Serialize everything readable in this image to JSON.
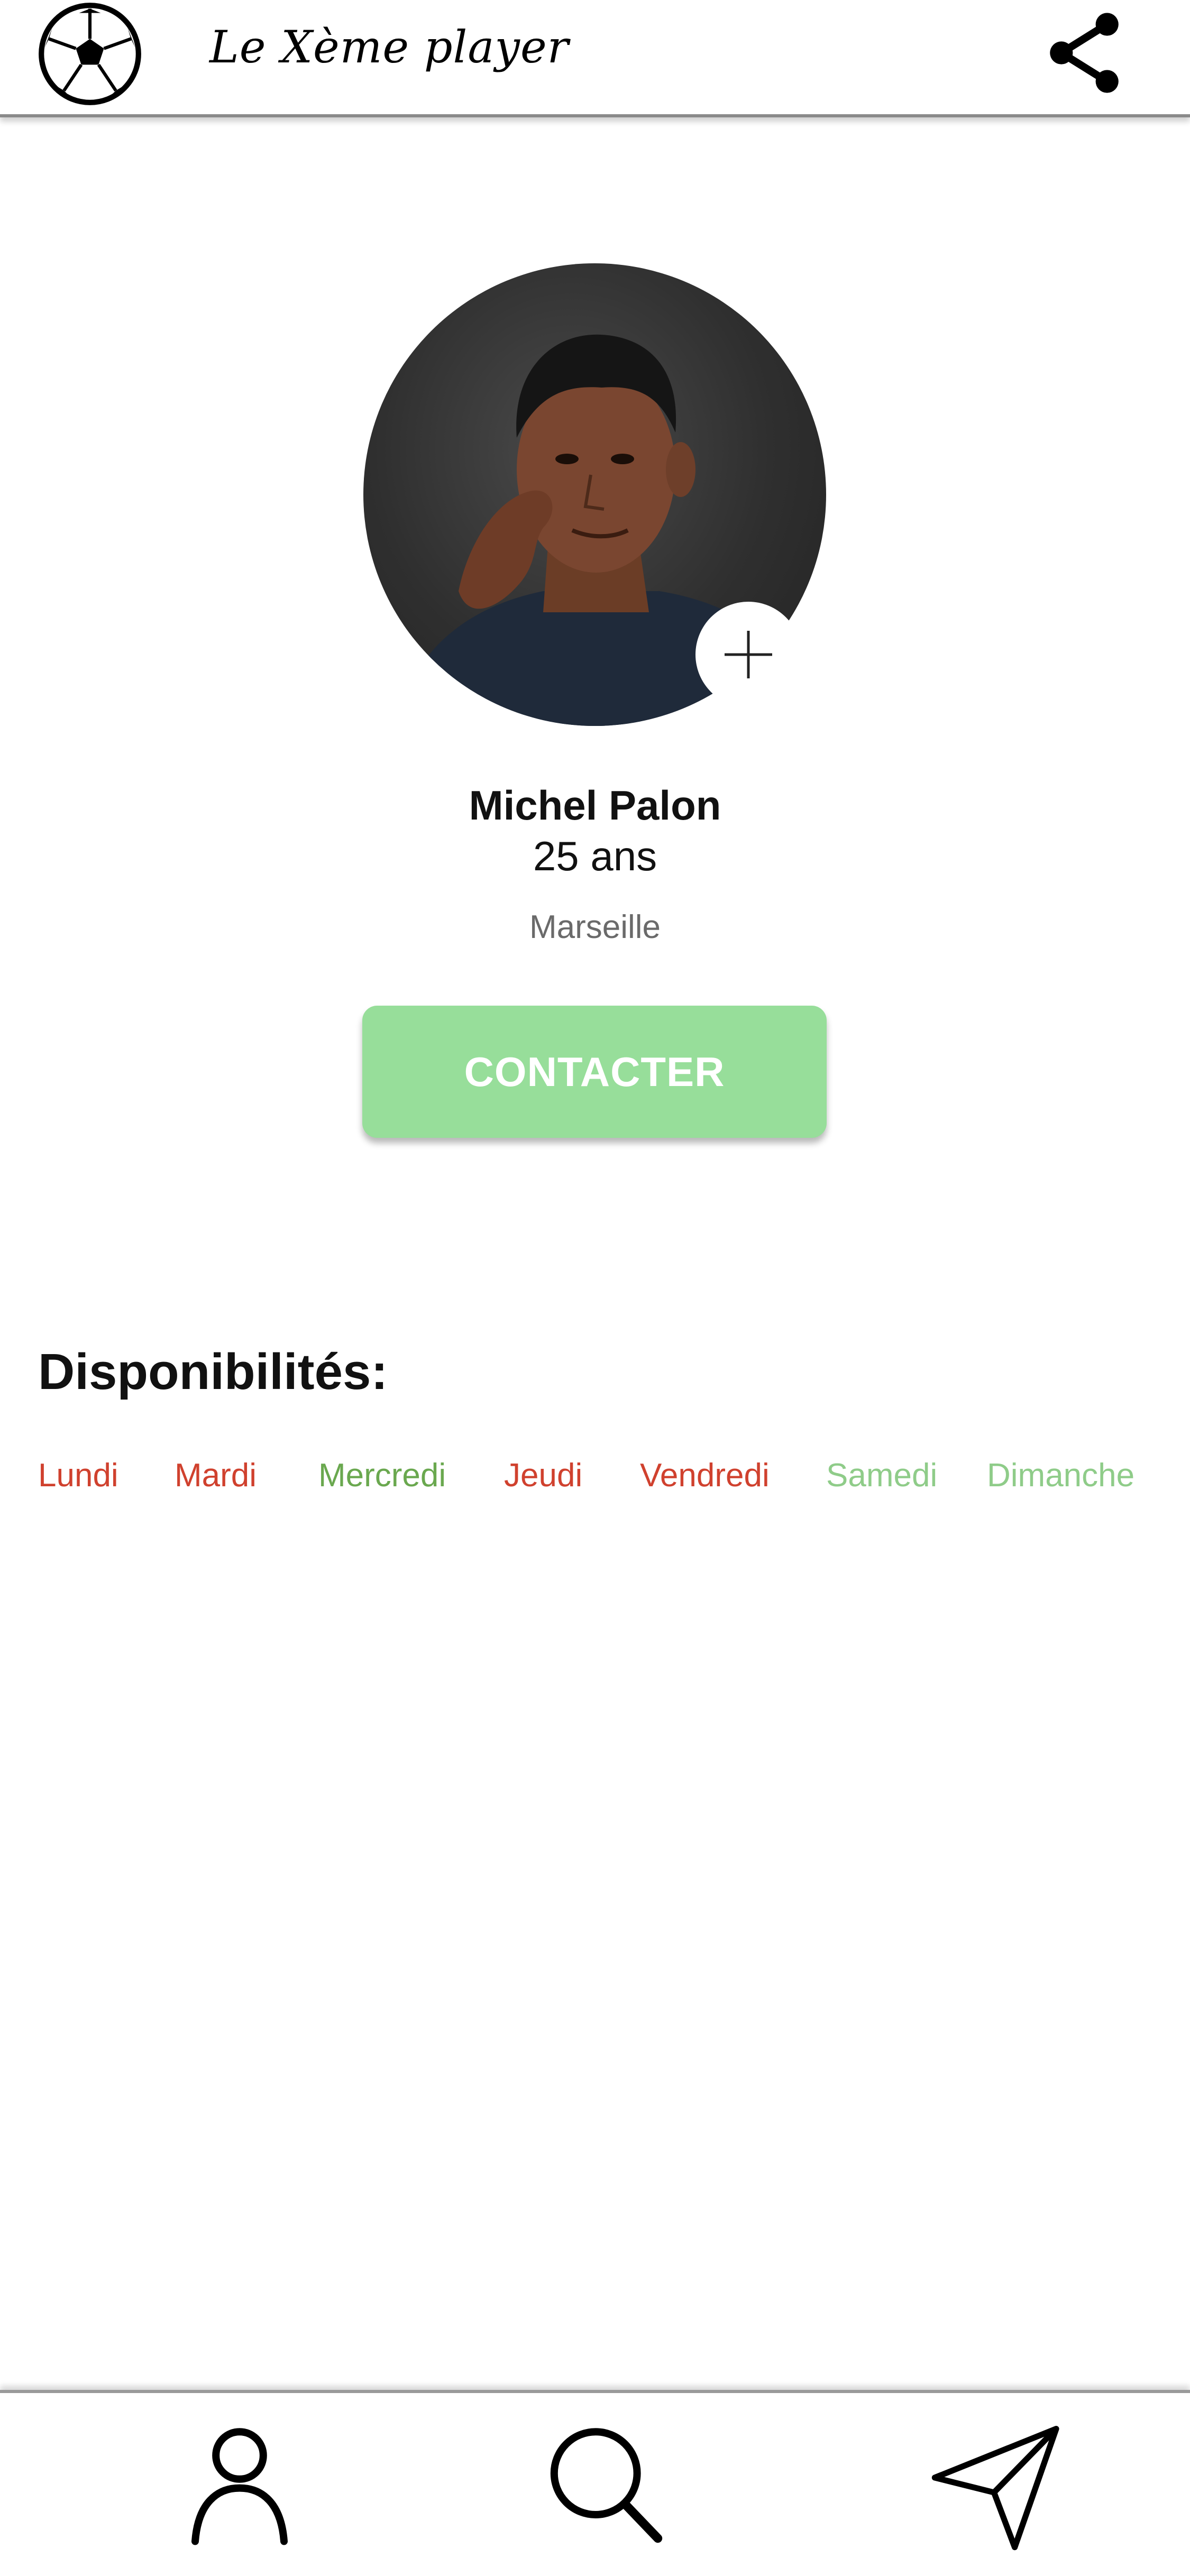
{
  "header": {
    "title": "Le Xème player",
    "logo_icon": "soccer-ball-icon",
    "share_icon": "share-icon"
  },
  "profile": {
    "avatar": "profile-photo",
    "add_photo_icon": "plus-icon",
    "name": "Michel Palon",
    "age": "25 ans",
    "city": "Marseille",
    "contact_label": "CONTACTER"
  },
  "availability": {
    "title": "Disponibilités:",
    "days": [
      {
        "label": "Lundi",
        "status": "unavailable",
        "color": "#d0412e"
      },
      {
        "label": "Mardi",
        "status": "unavailable",
        "color": "#d0412e"
      },
      {
        "label": "Mercredi",
        "status": "available",
        "color": "#6aa84f"
      },
      {
        "label": "Jeudi",
        "status": "unavailable",
        "color": "#d0412e"
      },
      {
        "label": "Vendredi",
        "status": "unavailable",
        "color": "#d0412e"
      },
      {
        "label": "Samedi",
        "status": "available",
        "color": "#8fcc89"
      },
      {
        "label": "Dimanche",
        "status": "available",
        "color": "#8fcc89"
      }
    ]
  },
  "bottom_nav": {
    "items": [
      {
        "icon": "user-icon"
      },
      {
        "icon": "search-icon"
      },
      {
        "icon": "send-icon"
      }
    ]
  },
  "colors": {
    "contact_button": "#97de9a",
    "unavailable": "#d0412e",
    "available": "#6aa84f",
    "available_light": "#8fcc89"
  }
}
